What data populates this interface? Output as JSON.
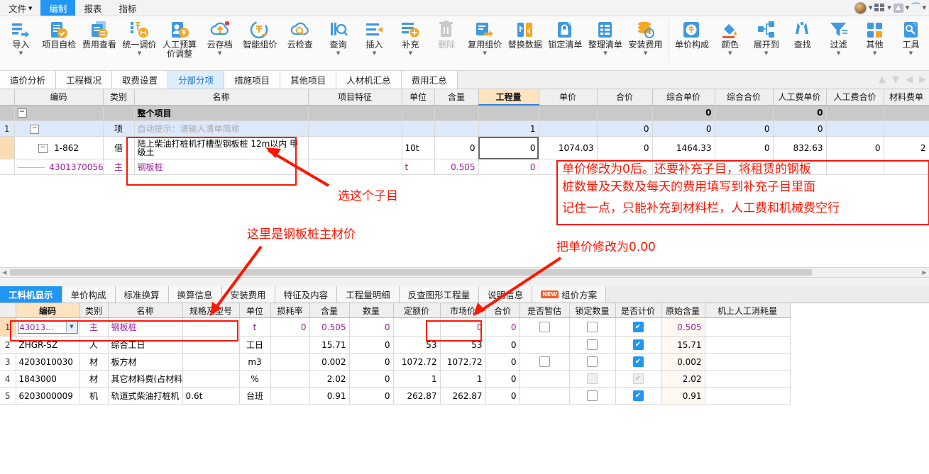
{
  "menubar": {
    "items": [
      {
        "label": "文件",
        "caret": true,
        "active": false
      },
      {
        "label": "编制",
        "caret": false,
        "active": true
      },
      {
        "label": "报表",
        "caret": false,
        "active": false
      },
      {
        "label": "指标",
        "caret": false,
        "active": false
      }
    ],
    "right_icons": [
      "avatar",
      "grid-icon",
      "upload-icon",
      "headset-icon"
    ]
  },
  "ribbon": {
    "buttons": [
      {
        "label": "导入",
        "icon": "import-icon",
        "dropdown": true
      },
      {
        "label": "项目自检",
        "icon": "project-check-icon",
        "dropdown": false
      },
      {
        "label": "费用查看",
        "icon": "fee-view-icon",
        "dropdown": false
      },
      {
        "label": "统一调价",
        "icon": "unified-price-icon",
        "dropdown": true
      },
      {
        "label": "人工预算价调整",
        "icon": "labor-budget-icon",
        "dropdown": false
      },
      {
        "label": "云存档",
        "icon": "cloud-archive-icon",
        "dropdown": true
      },
      {
        "label": "智能组价",
        "icon": "smart-price-icon",
        "dropdown": false
      },
      {
        "label": "云检查",
        "icon": "cloud-check-icon",
        "dropdown": false
      },
      {
        "label": "查询",
        "icon": "query-icon",
        "dropdown": true
      },
      {
        "label": "插入",
        "icon": "insert-icon",
        "dropdown": true
      },
      {
        "label": "补充",
        "icon": "supplement-icon",
        "dropdown": true
      },
      {
        "label": "删除",
        "icon": "delete-icon",
        "dropdown": false,
        "disabled": true
      },
      {
        "label": "复用组价",
        "icon": "reuse-price-icon",
        "dropdown": true
      },
      {
        "label": "替换数据",
        "icon": "replace-data-icon",
        "dropdown": false
      },
      {
        "label": "锁定清单",
        "icon": "lock-list-icon",
        "dropdown": false
      },
      {
        "label": "整理清单",
        "icon": "organize-list-icon",
        "dropdown": true
      },
      {
        "label": "安装费用",
        "icon": "install-fee-icon",
        "dropdown": true
      },
      {
        "label": "单价构成",
        "icon": "price-composition-icon",
        "dropdown": false
      },
      {
        "label": "颜色",
        "icon": "color-icon",
        "dropdown": true
      },
      {
        "label": "展开到",
        "icon": "expand-to-icon",
        "dropdown": true
      },
      {
        "label": "查找",
        "icon": "find-icon",
        "dropdown": false
      },
      {
        "label": "过滤",
        "icon": "filter-icon",
        "dropdown": true
      },
      {
        "label": "其他",
        "icon": "other-icon",
        "dropdown": true
      },
      {
        "label": "工具",
        "icon": "tools-icon",
        "dropdown": true
      }
    ]
  },
  "tabstrip": {
    "tabs": [
      {
        "label": "造价分析",
        "selected": false
      },
      {
        "label": "工程概况",
        "selected": false
      },
      {
        "label": "取费设置",
        "selected": false
      },
      {
        "label": "分部分项",
        "selected": true
      },
      {
        "label": "措施项目",
        "selected": false
      },
      {
        "label": "其他项目",
        "selected": false
      },
      {
        "label": "人材机汇总",
        "selected": false
      },
      {
        "label": "费用汇总",
        "selected": false
      }
    ],
    "nav_icons": [
      "arrow-up-icon",
      "arrow-down-icon",
      "arrow-left-icon",
      "arrow-right-icon"
    ]
  },
  "upper_grid": {
    "columns": [
      "编码",
      "类别",
      "名称",
      "项目特征",
      "单位",
      "含量",
      "工程量",
      "单价",
      "合价",
      "综合单价",
      "综合合价",
      "人工费单价",
      "人工费合价",
      "材料费单"
    ],
    "highlight_column": "工程量",
    "rows": [
      {
        "type": "total",
        "row_no": "",
        "code": "",
        "expander": "−",
        "category": "",
        "name": "整个项目",
        "feature": "",
        "unit": "",
        "content": "",
        "quantity": "",
        "unit_price": "",
        "total_price": "",
        "comp_unit_price": "0",
        "comp_total_price": "",
        "labor_unit_price": "0",
        "labor_total_price": "",
        "material_unit_price": ""
      },
      {
        "type": "item",
        "row_no": "1",
        "code": "",
        "expander": "−",
        "category": "项",
        "name": "自动提示：请输入清单简称",
        "feature": "",
        "unit": "",
        "content": "",
        "quantity": "1",
        "unit_price": "",
        "total_price": "0",
        "comp_unit_price": "0",
        "comp_total_price": "0",
        "labor_unit_price": "0",
        "labor_total_price": "",
        "material_unit_price": ""
      },
      {
        "type": "sub",
        "row_no": "",
        "code": "1-862",
        "expander": "−",
        "category": "借",
        "name": "陆上柴油打桩机打槽型钢板桩 12m以内 甲级土",
        "feature": "",
        "unit": "10t",
        "content": "0",
        "quantity": "0",
        "unit_price": "1074.03",
        "total_price": "0",
        "comp_unit_price": "1464.33",
        "comp_total_price": "0",
        "labor_unit_price": "832.63",
        "labor_total_price": "0",
        "material_unit_price": "2"
      },
      {
        "type": "mat",
        "row_no": "",
        "code": "4301370056",
        "expander": "",
        "category": "主",
        "name": "钢板桩",
        "feature": "",
        "unit": "t",
        "content": "0.505",
        "quantity": "0",
        "unit_price": "",
        "total_price": "",
        "comp_unit_price": "",
        "comp_total_price": "",
        "labor_unit_price": "",
        "labor_total_price": "",
        "material_unit_price": ""
      }
    ]
  },
  "bottom_tabs": {
    "tabs": [
      {
        "label": "工料机显示",
        "selected": true,
        "badge": ""
      },
      {
        "label": "单价构成",
        "selected": false,
        "badge": ""
      },
      {
        "label": "标准换算",
        "selected": false,
        "badge": ""
      },
      {
        "label": "换算信息",
        "selected": false,
        "badge": ""
      },
      {
        "label": "安装费用",
        "selected": false,
        "badge": ""
      },
      {
        "label": "特征及内容",
        "selected": false,
        "badge": ""
      },
      {
        "label": "工程量明细",
        "selected": false,
        "badge": ""
      },
      {
        "label": "反查图形工程量",
        "selected": false,
        "badge": ""
      },
      {
        "label": "说明信息",
        "selected": false,
        "badge": ""
      },
      {
        "label": "组价方案",
        "selected": false,
        "badge": "NEW"
      }
    ]
  },
  "lower_grid": {
    "columns": [
      "编码",
      "类别",
      "名称",
      "规格及型号",
      "单位",
      "损耗率",
      "含量",
      "数量",
      "定额价",
      "市场价",
      "合价",
      "是否暂估",
      "锁定数量",
      "是否计价",
      "原始含量",
      "机上人工消耗量"
    ],
    "highlight_column": "编码",
    "rows": [
      {
        "no": "1",
        "code": "43013…",
        "category": "主",
        "name": "钢板桩",
        "spec": "",
        "unit": "t",
        "loss_rate": "0",
        "content": "0.505",
        "qty": "0",
        "quota_price": "",
        "market_price": "0",
        "total": "0",
        "is_estimated": "unchecked",
        "lock_qty": "unchecked",
        "is_priced": "checked",
        "orig_content": "0.505",
        "labor_consumption": "",
        "editing": true
      },
      {
        "no": "2",
        "code": "ZHGR-SZ",
        "category": "人",
        "name": "综合工日",
        "spec": "",
        "unit": "工日",
        "loss_rate": "",
        "content": "15.71",
        "qty": "0",
        "quota_price": "53",
        "market_price": "53",
        "total": "0",
        "is_estimated": "none",
        "lock_qty": "unchecked",
        "is_priced": "checked",
        "orig_content": "15.71",
        "labor_consumption": "",
        "editing": false
      },
      {
        "no": "3",
        "code": "4203010030",
        "category": "材",
        "name": "板方材",
        "spec": "",
        "unit": "m3",
        "loss_rate": "",
        "content": "0.002",
        "qty": "0",
        "quota_price": "1072.72",
        "market_price": "1072.72",
        "total": "0",
        "is_estimated": "unchecked",
        "lock_qty": "unchecked",
        "is_priced": "checked",
        "orig_content": "0.002",
        "labor_consumption": "",
        "editing": false
      },
      {
        "no": "4",
        "code": "1843000",
        "category": "材",
        "name": "其它材料费(占材料费)",
        "spec": "",
        "unit": "%",
        "loss_rate": "",
        "content": "2.02",
        "qty": "0",
        "quota_price": "1",
        "market_price": "1",
        "total": "0",
        "is_estimated": "none",
        "lock_qty": "disabled",
        "is_priced": "disabled",
        "orig_content": "2.02",
        "labor_consumption": "",
        "editing": false
      },
      {
        "no": "5",
        "code": "6203000009",
        "category": "机",
        "name": "轨道式柴油打桩机",
        "spec": "0.6t",
        "unit": "台班",
        "loss_rate": "",
        "content": "0.91",
        "qty": "0",
        "quota_price": "262.87",
        "market_price": "262.87",
        "total": "0",
        "is_estimated": "none",
        "lock_qty": "unchecked",
        "is_priced": "checked",
        "orig_content": "0.91",
        "labor_consumption": "",
        "editing": false
      }
    ]
  },
  "annotations": {
    "select_subitem": "选这个子目",
    "main_material_price": "这里是钢板桩主材价",
    "change_unit_price": "把单价修改为0.00",
    "instruction_line1": "单价修改为0后。还要补充子目，将租赁的钢板",
    "instruction_line2": "桩数量及天数及每天的费用填写到补充子目里面",
    "instruction_line3": "记住一点，只能补充到材料栏，人工费和机械费空行",
    "color": "#ff1500"
  }
}
